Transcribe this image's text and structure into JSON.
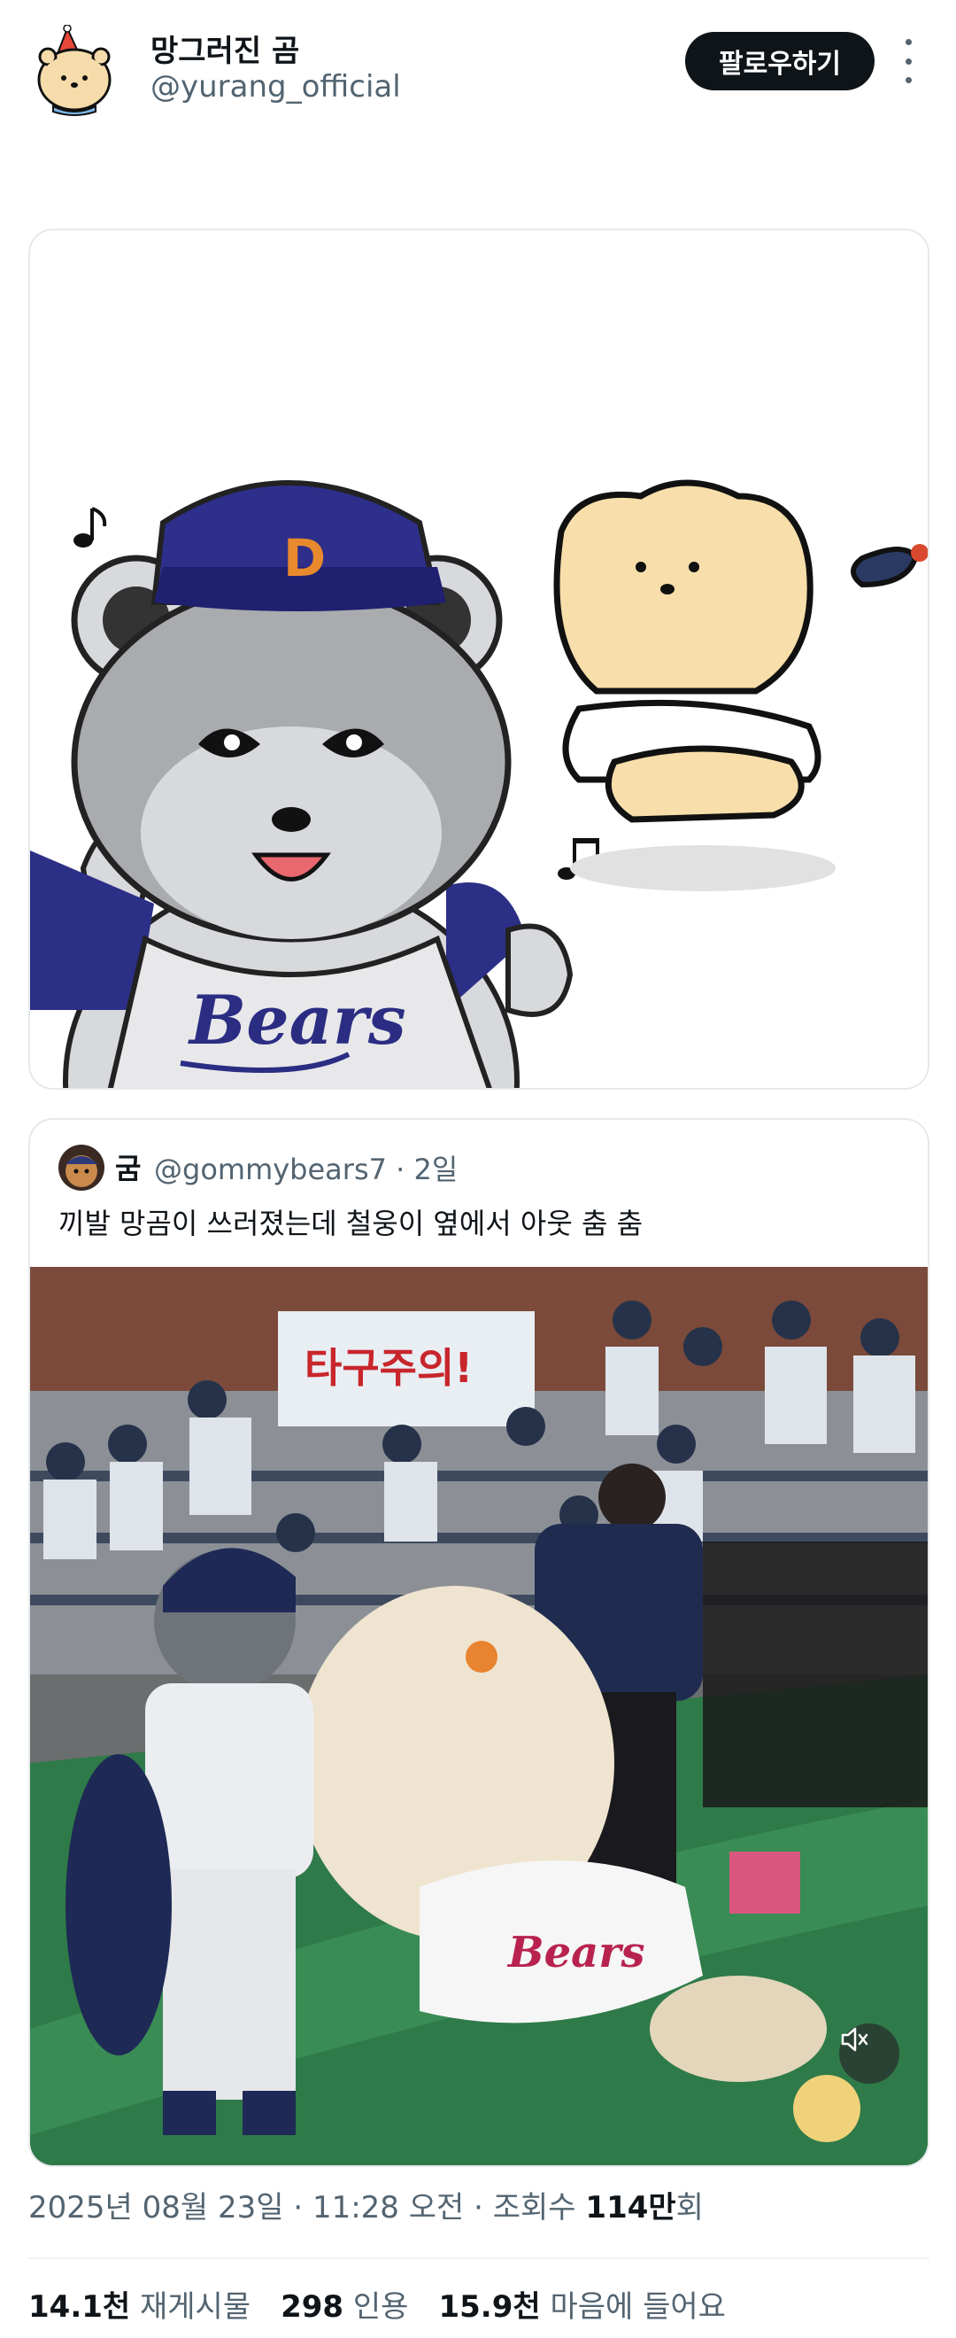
{
  "header": {
    "display_name": "망그러진 곰",
    "handle": "@yurang_official",
    "follow_label": "팔로우하기",
    "avatar_icon": "bear-with-party-hat-avatar"
  },
  "media": {
    "image_icon": "bears-mascot-and-fallen-bear-illustration",
    "mascot_cap_letter": "D",
    "shirt_text": "Bears"
  },
  "quote": {
    "name": "굼",
    "handle": "@gommybears7",
    "separator": "·",
    "time": "2일",
    "text": "끼발 망곰이 쓰러졌는데 철웅이 옆에서 아웃 춤 춤",
    "video_icon": "stadium-mascots-video-thumbnail",
    "banner_text": "타구주의!",
    "mute_icon": "speaker-muted-icon"
  },
  "meta": {
    "date": "2025년 08월 23일",
    "dot1": " · ",
    "time": "11:28 오전",
    "dot2": " · ",
    "views_label": "조회수 ",
    "views_value": "114만",
    "views_suffix": "회"
  },
  "stats": {
    "retweets_value": "14.1천",
    "retweets_label": "재게시물",
    "quotes_value": "298",
    "quotes_label": "인용",
    "likes_value": "15.9천",
    "likes_label": "마음에 들어요"
  }
}
